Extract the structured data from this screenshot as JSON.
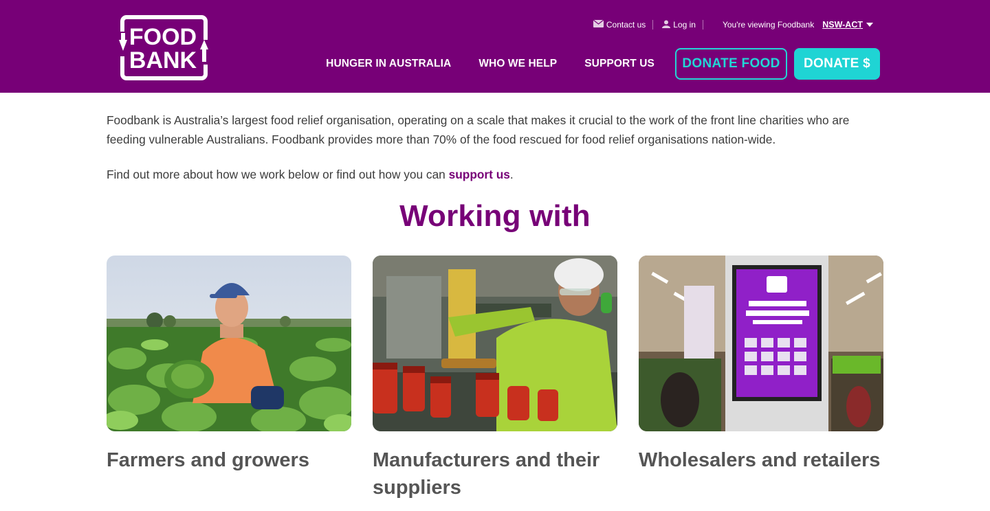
{
  "brand": {
    "logo_text_line1": "FOOD",
    "logo_text_line2": "BANK",
    "primary_color": "#770077",
    "accent_color": "#1fd4d4"
  },
  "utility": {
    "contact": "Contact us",
    "contact_icon": "envelope-icon",
    "login": "Log in",
    "login_icon": "user-icon",
    "viewing": "You're viewing Foodbank",
    "region": "NSW-ACT",
    "region_icon": "caret-down-icon"
  },
  "nav": {
    "items": [
      "HUNGER IN AUSTRALIA",
      "WHO WE HELP",
      "SUPPORT US"
    ],
    "donate_food": "DONATE FOOD",
    "donate_money": "DONATE $"
  },
  "intro": {
    "paragraph": "Foodbank is Australia’s largest food relief organisation, operating on a scale that makes it crucial to the work of the front line charities who are feeding vulnerable Australians. Foodbank provides more than 70% of the food rescued for food relief organisations nation-wide.",
    "more_prefix": "Find out more about how we work below or find out how you can ",
    "more_link": "support us",
    "more_suffix": "."
  },
  "section": {
    "title": "Working with"
  },
  "cards": [
    {
      "title": "Farmers and growers"
    },
    {
      "title": "Manufacturers and their suppliers"
    },
    {
      "title": "Wholesalers and retailers"
    }
  ]
}
